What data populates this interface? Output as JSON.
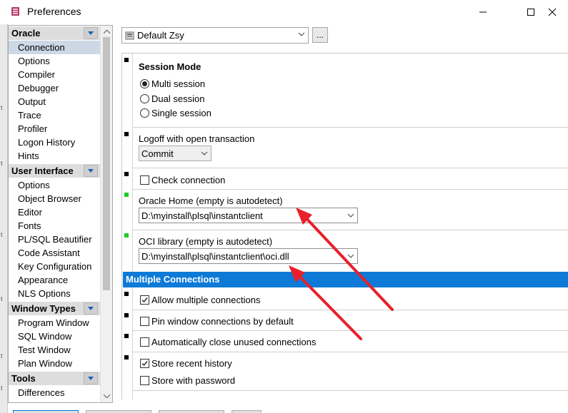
{
  "window": {
    "title": "Preferences",
    "icons": {
      "app": "preferences-app-icon",
      "minimize": "minimize-icon",
      "maximize": "maximize-icon",
      "close": "close-icon"
    }
  },
  "sidebar": {
    "groups": [
      {
        "label": "Oracle",
        "items": [
          "Connection",
          "Options",
          "Compiler",
          "Debugger",
          "Output",
          "Trace",
          "Profiler",
          "Logon History",
          "Hints"
        ]
      },
      {
        "label": "User Interface",
        "items": [
          "Options",
          "Object Browser",
          "Editor",
          "Fonts",
          "PL/SQL Beautifier",
          "Code Assistant",
          "Key Configuration",
          "Appearance",
          "NLS Options"
        ]
      },
      {
        "label": "Window Types",
        "items": [
          "Program Window",
          "SQL Window",
          "Test Window",
          "Plan Window"
        ]
      },
      {
        "label": "Tools",
        "items": [
          "Differences"
        ]
      }
    ],
    "selected": "Connection"
  },
  "profile": {
    "value": "Default Zsy",
    "more_label": "..."
  },
  "session_mode": {
    "title": "Session Mode",
    "options": [
      "Multi session",
      "Dual session",
      "Single session"
    ],
    "selected": "Multi session"
  },
  "logoff": {
    "label": "Logoff with open transaction",
    "value": "Commit"
  },
  "check_connection": {
    "label": "Check connection",
    "checked": false
  },
  "oracle_home": {
    "label": "Oracle Home (empty is autodetect)",
    "value": "D:\\myinstall\\plsql\\instantclient"
  },
  "oci_library": {
    "label": "OCI library (empty is autodetect)",
    "value": "D:\\myinstall\\plsql\\instantclient\\oci.dll"
  },
  "multiple_connections": {
    "title": "Multiple Connections",
    "allow": {
      "label": "Allow multiple connections",
      "checked": true
    },
    "pin": {
      "label": "Pin window connections by default",
      "checked": false
    },
    "auto_close": {
      "label": "Automatically close unused connections",
      "checked": false
    },
    "store_recent": {
      "label": "Store recent history",
      "checked": true
    },
    "store_password": {
      "label": "Store with password",
      "checked": false
    }
  },
  "left_edge_marks": [
    "t",
    "t",
    "t",
    "t",
    "t",
    "t"
  ],
  "colors": {
    "section_header": "#0c7ad6",
    "annotation_arrow": "#e8202a",
    "changed_marker": "#22cc22",
    "selected_item": "#ccd8e6"
  }
}
